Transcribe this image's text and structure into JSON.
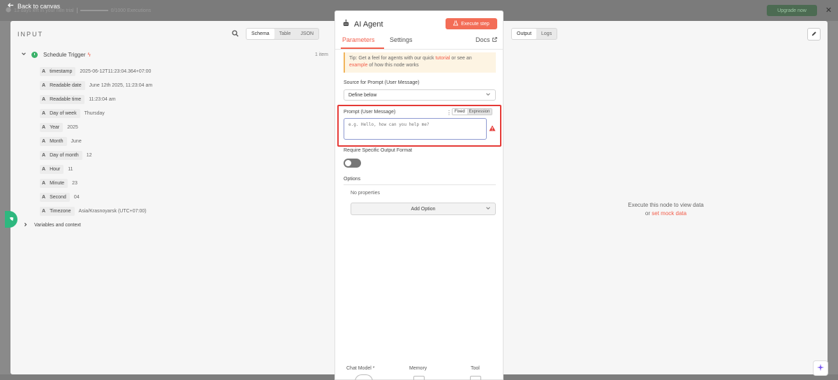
{
  "topbar": {
    "back_label": "Back to canvas",
    "trial_text": "13 days left in your n8n trial",
    "executions": "0/1000 Executions",
    "upgrade_label": "Upgrade now"
  },
  "input": {
    "title": "INPUT",
    "view_tabs": [
      "Schema",
      "Table",
      "JSON"
    ],
    "active_tab": "Schema",
    "trigger_name": "Schedule Trigger",
    "item_count": "1 item",
    "fields": [
      {
        "name": "timestamp",
        "value": "2025-06-12T11:23:04.364+07:00"
      },
      {
        "name": "Readable date",
        "value": "June 12th 2025, 11:23:04 am"
      },
      {
        "name": "Readable time",
        "value": "11:23:04 am"
      },
      {
        "name": "Day of week",
        "value": "Thursday"
      },
      {
        "name": "Year",
        "value": "2025"
      },
      {
        "name": "Month",
        "value": "June"
      },
      {
        "name": "Day of month",
        "value": "12"
      },
      {
        "name": "Hour",
        "value": "11"
      },
      {
        "name": "Minute",
        "value": "23"
      },
      {
        "name": "Second",
        "value": "04"
      },
      {
        "name": "Timezone",
        "value": "Asia/Krasnoyarsk (UTC+07:00)"
      }
    ],
    "field_type": "A",
    "variables_label": "Variables and context"
  },
  "node": {
    "title": "AI Agent",
    "execute_label": "Execute step",
    "tabs": {
      "parameters": "Parameters",
      "settings": "Settings",
      "docs": "Docs"
    },
    "tip": {
      "prefix": "Tip: Get a feel for agents with our quick ",
      "link1": "tutorial",
      "middle": " or see an ",
      "link2": "example",
      "suffix": " of how this node works"
    },
    "source_label": "Source for Prompt (User Message)",
    "source_value": "Define below",
    "prompt_label": "Prompt (User Message)",
    "prompt_mode_fixed": "Fixed",
    "prompt_mode_expression": "Expression",
    "prompt_placeholder": "e.g. Hello, how can you help me?",
    "output_format_label": "Require Specific Output Format",
    "output_format_enabled": false,
    "options_label": "Options",
    "no_properties": "No properties",
    "add_option_label": "Add Option",
    "sub_nodes": [
      "Chat Model *",
      "Memory",
      "Tool"
    ]
  },
  "output": {
    "view_tabs": [
      "Output",
      "Logs"
    ],
    "active_tab": "Output",
    "empty_line1": "Execute this node to view data",
    "empty_prefix": "or ",
    "empty_link": "set mock data"
  },
  "colors": {
    "accent": "#f25d4a",
    "execute_button": "#f36d57",
    "highlight_box": "#e53935",
    "trigger_green": "#3bb26a"
  }
}
